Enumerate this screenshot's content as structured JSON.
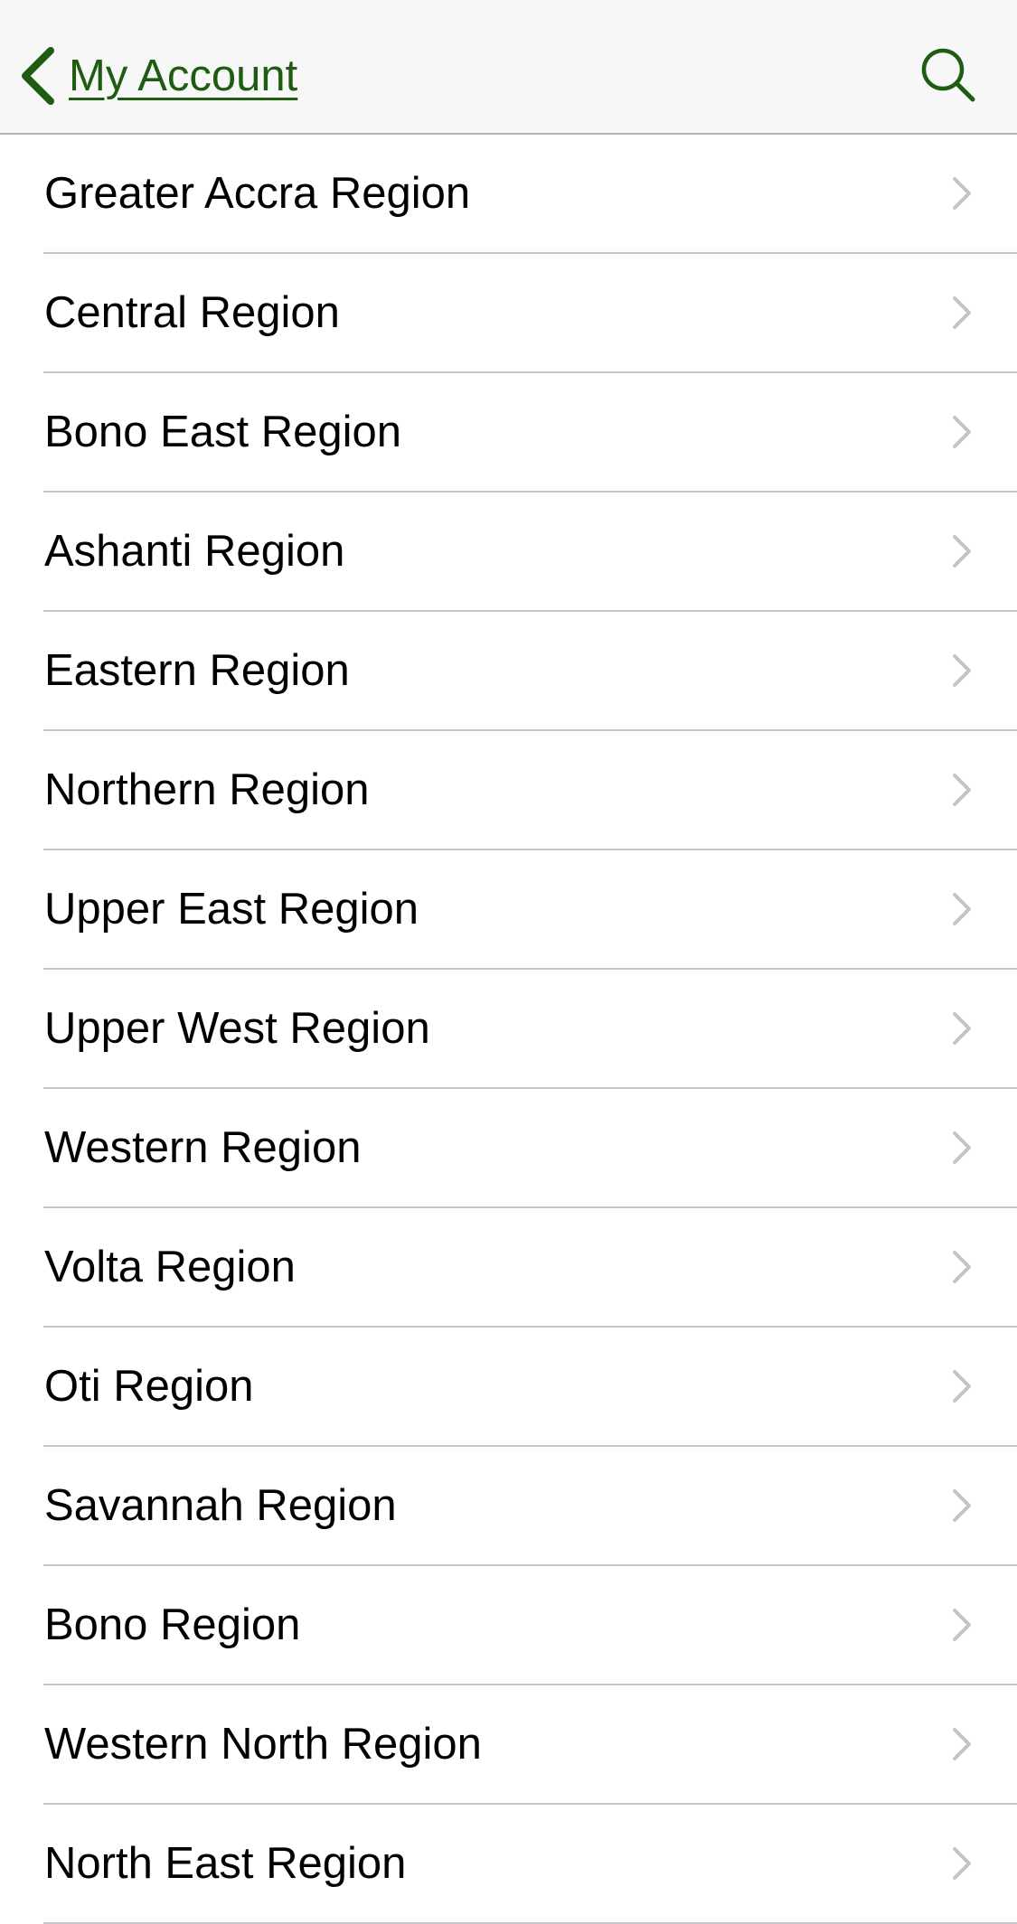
{
  "nav": {
    "back_label": "My Account",
    "back_icon": "chevron-left-icon",
    "search_icon": "search-icon",
    "accent_color": "#1e5c12"
  },
  "regions": [
    {
      "label": "Greater Accra Region"
    },
    {
      "label": "Central Region"
    },
    {
      "label": "Bono East Region"
    },
    {
      "label": "Ashanti Region"
    },
    {
      "label": "Eastern Region"
    },
    {
      "label": "Northern Region"
    },
    {
      "label": "Upper East Region"
    },
    {
      "label": "Upper West Region"
    },
    {
      "label": "Western Region"
    },
    {
      "label": "Volta Region"
    },
    {
      "label": "Oti Region"
    },
    {
      "label": "Savannah Region"
    },
    {
      "label": "Bono Region"
    },
    {
      "label": "Western North Region"
    },
    {
      "label": "North East Region"
    }
  ],
  "row_icon": "chevron-right-icon",
  "text_color": "#000000",
  "separator_color": "#c8c7cc",
  "disclosure_color": "#c4c4c7"
}
